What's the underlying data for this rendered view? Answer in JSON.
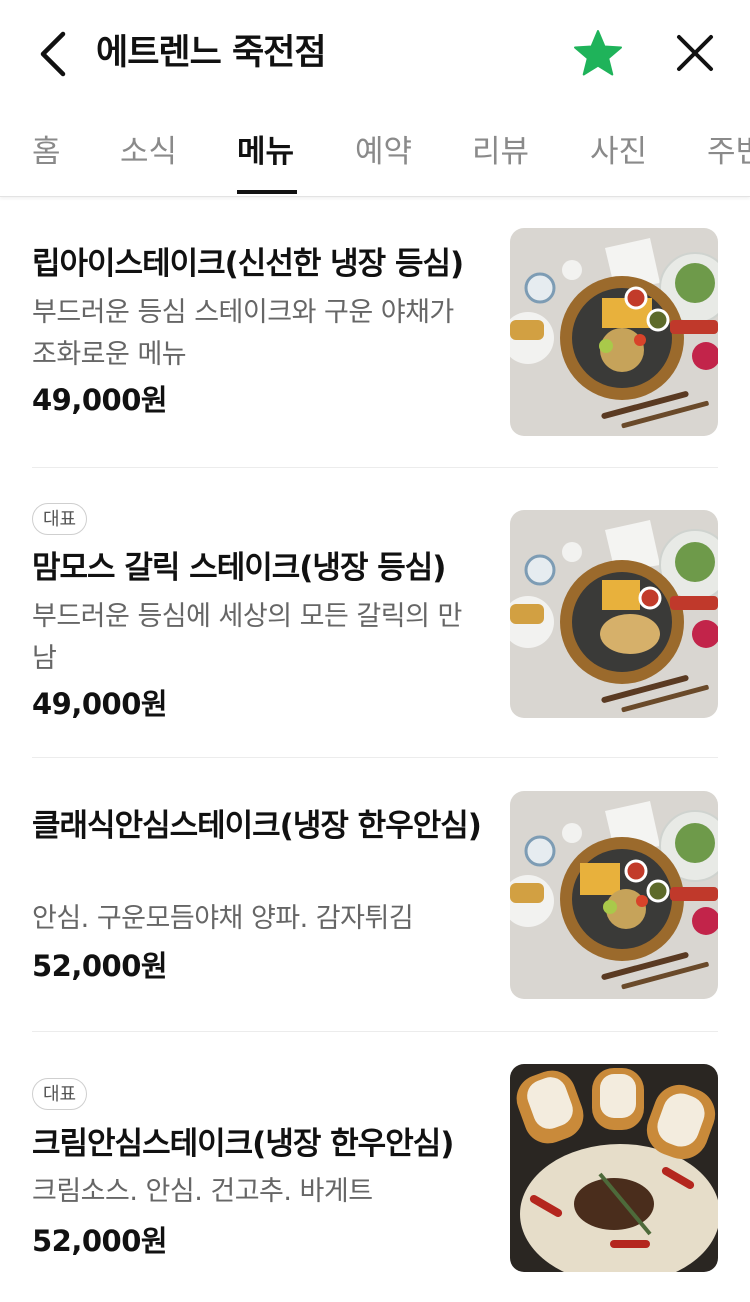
{
  "header": {
    "title": "에트렌느 죽전점"
  },
  "tabs": [
    {
      "label": "홈"
    },
    {
      "label": "소식"
    },
    {
      "label": "메뉴"
    },
    {
      "label": "예약"
    },
    {
      "label": "리뷰"
    },
    {
      "label": "사진"
    },
    {
      "label": "주변"
    }
  ],
  "active_tab": "메뉴",
  "colors": {
    "star": "#1fb35a",
    "text": "#111111",
    "muted": "#666666",
    "tab_inactive": "#8a8a8a"
  },
  "menu": [
    {
      "badge": "",
      "name": "립아이스테이크(신선한 냉장 등심)",
      "desc": "부드러운 등심 스테이크와 구운 야채가 조화로운 메뉴",
      "price": "49,000원",
      "image": "steak-plate-vegetables-photo"
    },
    {
      "badge": "대표",
      "name": "맘모스 갈릭 스테이크(냉장 등심)",
      "desc": "부드러운 등심에 세상의 모든 갈릭의 만남",
      "price": "49,000원",
      "image": "garlic-steak-plate-photo"
    },
    {
      "badge": "",
      "name": "클래식안심스테이크(냉장 한우안심)",
      "desc": "안심. 구운모듬야채 양파. 감자튀김",
      "price": "52,000원",
      "image": "tenderloin-steak-plate-photo"
    },
    {
      "badge": "대표",
      "name": "크림안심스테이크(냉장 한우안심)",
      "desc": "크림소스. 안심. 건고추. 바게트",
      "price": "52,000원",
      "image": "cream-steak-baguette-photo"
    }
  ]
}
